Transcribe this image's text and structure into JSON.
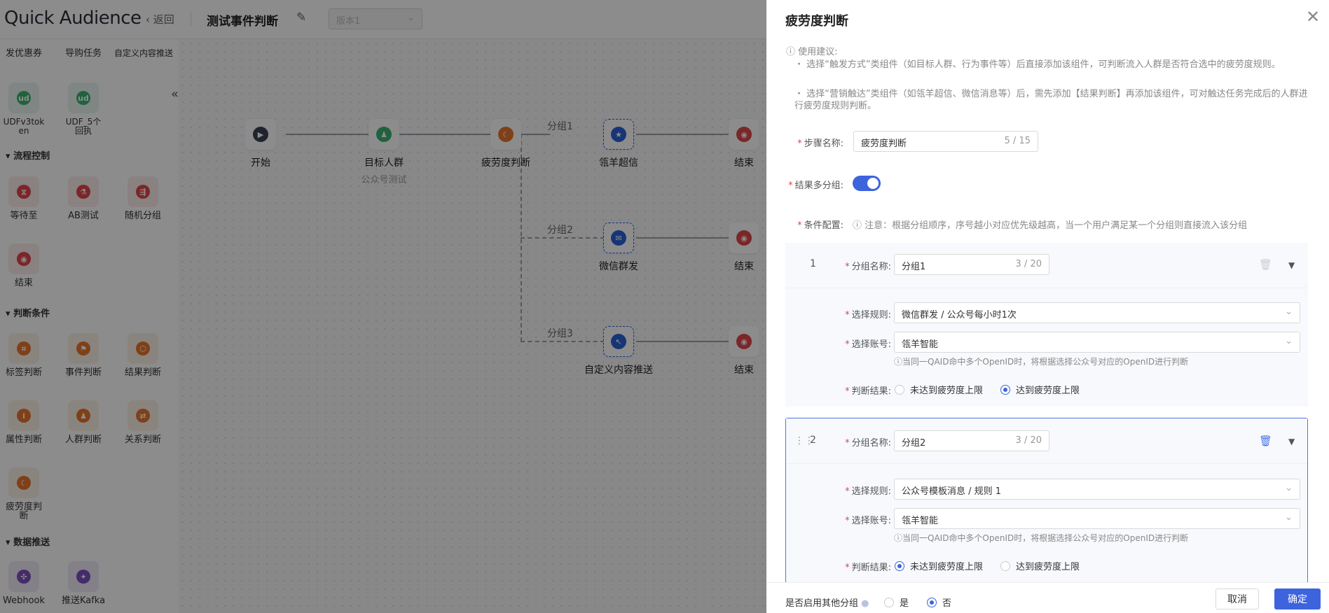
{
  "header": {
    "logo": "Quick Audience",
    "back": "‹ 返回",
    "title": "测试事件判断",
    "version_placeholder": "版本1"
  },
  "sidebar": {
    "top_items": [
      "发优惠券",
      "导购任务",
      "自定义内容推送"
    ],
    "udf_items": [
      "UDFv3token",
      "UDF_5个回执"
    ],
    "sections": [
      {
        "title": "流程控制",
        "items": [
          "等待至",
          "AB测试",
          "随机分组",
          "结束"
        ]
      },
      {
        "title": "判断条件",
        "items": [
          "标签判断",
          "事件判断",
          "结果判断",
          "属性判断",
          "人群判断",
          "关系判断",
          "疲劳度判断"
        ]
      },
      {
        "title": "数据推送",
        "items": [
          "Webhook",
          "推送Kafka"
        ]
      }
    ]
  },
  "canvas": {
    "nodes": {
      "start": "开始",
      "target": "目标人群",
      "target_sub": "公众号测试",
      "fatigue": "疲劳度判断",
      "lingyang": "瓴羊超信",
      "wechat": "微信群发",
      "custom": "自定义内容推送",
      "end": "结束"
    },
    "groups": [
      "分组1",
      "分组2",
      "分组3"
    ]
  },
  "drawer": {
    "title": "疲劳度判断",
    "tip_title": "ⓘ 使用建议:",
    "tip_1": "・ 选择“触发方式”类组件（如目标人群、行为事件等）后直接添加该组件，可判断流入人群是否符合选中的疲劳度规则。",
    "tip_2": "・ 选择“营销触达”类组件（如瓴羊超信、微信消息等）后，需先添加【结果判断】再添加该组件，可对触达任务完成后的人群进行疲劳度规则判断。",
    "step_label": "步骤名称:",
    "step_value": "疲劳度判断",
    "step_count": "5 / 15",
    "multi_label": "结果多分组:",
    "cond_label": "条件配置:",
    "cond_note": "ⓘ 注意：根据分组顺序，序号越小对应优先级越高，当一个用户满足某一个分组则直接流入该分组",
    "group_name_label": "分组名称:",
    "rule_label": "选择规则:",
    "account_label": "选择账号:",
    "result_label": "判断结果:",
    "hint": "ⓘ当同一QAID命中多个OpenID时，将根据选择公众号对应的OpenID进行判断",
    "opt_not_reached": "未达到疲劳度上限",
    "opt_reached": "达到疲劳度上限",
    "groups": [
      {
        "num": "1",
        "name": "分组1",
        "count": "3 / 20",
        "rule": "微信群发 / 公众号每小时1次",
        "account": "瓴羊智能"
      },
      {
        "num": "2",
        "name": "分组2",
        "count": "3 / 20",
        "rule": "公众号模板消息 / 规则 1",
        "account": "瓴羊智能"
      }
    ],
    "footer": {
      "other_label": "是否启用其他分组",
      "yes": "是",
      "no": "否",
      "cancel": "取消",
      "ok": "确定"
    }
  }
}
